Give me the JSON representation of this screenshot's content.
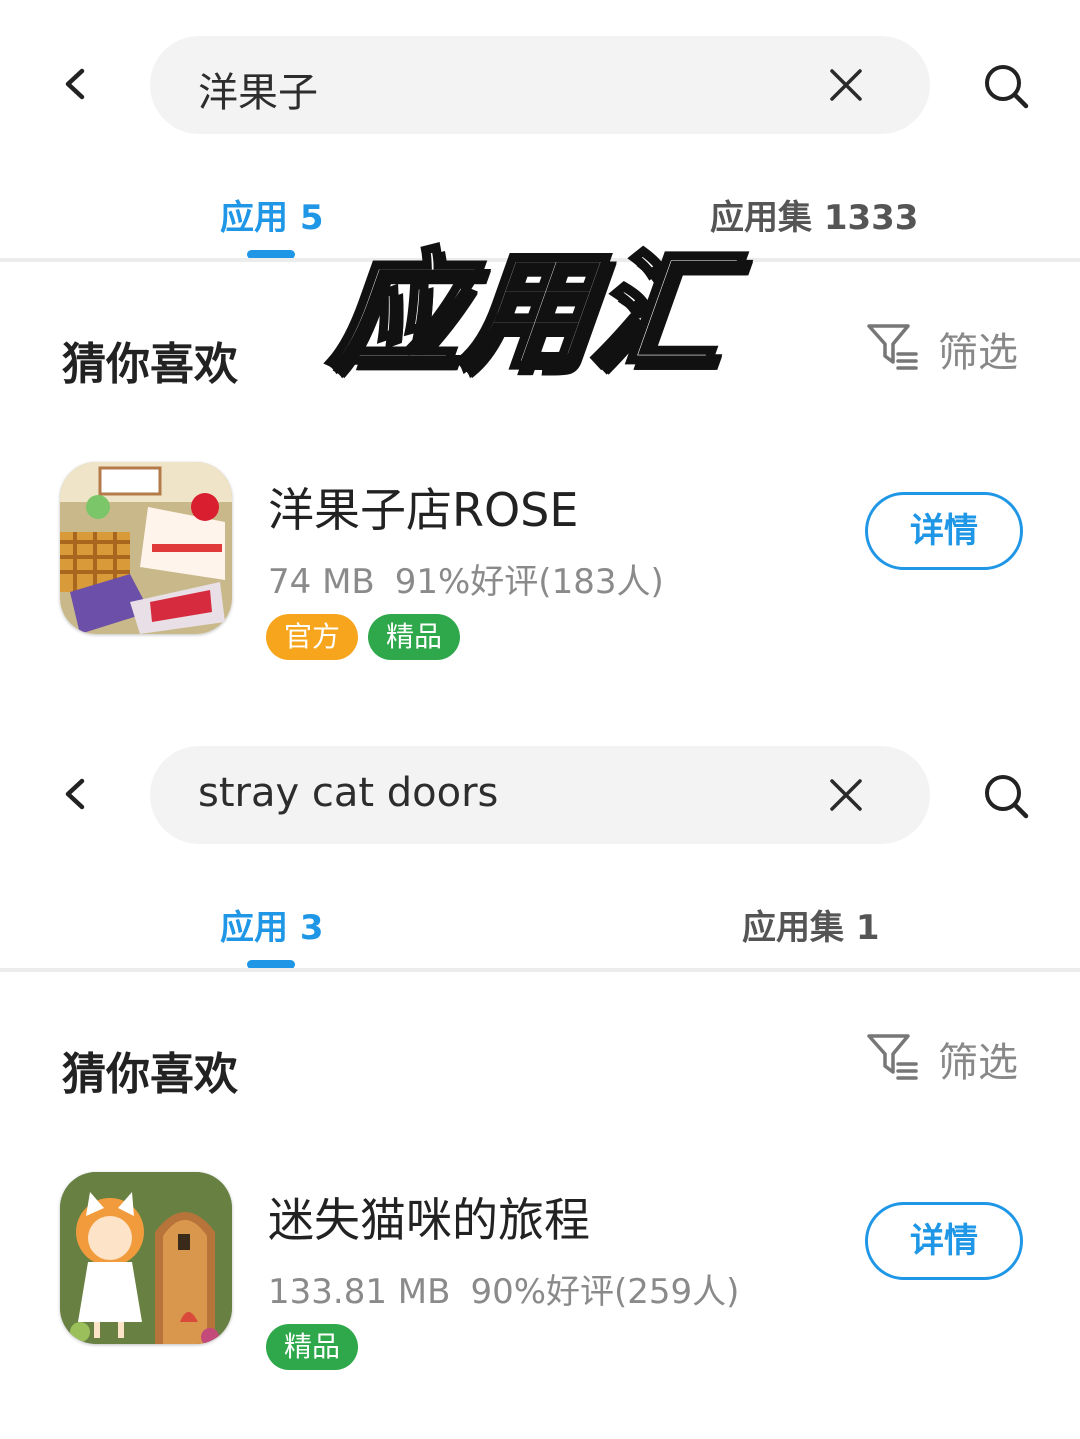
{
  "search_1": {
    "query": "洋果子",
    "tabs": [
      {
        "label": "应用 5"
      },
      {
        "label": "应用集 1333"
      }
    ],
    "section_title": "猜你喜欢",
    "filter_label": "筛选",
    "app": {
      "name": "洋果子店ROSE",
      "size": "74 MB",
      "rating": "91%好评(183人)",
      "badges": [
        "官方",
        "精品"
      ],
      "detail_label": "详情"
    }
  },
  "search_2": {
    "query": "stray cat doors",
    "tabs": [
      {
        "label": "应用 3"
      },
      {
        "label": "应用集 1"
      }
    ],
    "section_title": "猜你喜欢",
    "filter_label": "筛选",
    "app": {
      "name": "迷失猫咪的旅程",
      "size": "133.81 MB",
      "rating": "90%好评(259人)",
      "badges": [
        "精品"
      ],
      "detail_label": "详情"
    }
  },
  "overlay_title": "应用汇",
  "colors": {
    "accent": "#1f97e6",
    "badge_official": "#f7a51d",
    "badge_premium": "#2ea84a"
  },
  "icons": [
    "back-arrow-icon",
    "clear-x-icon",
    "search-icon",
    "filter-icon"
  ]
}
